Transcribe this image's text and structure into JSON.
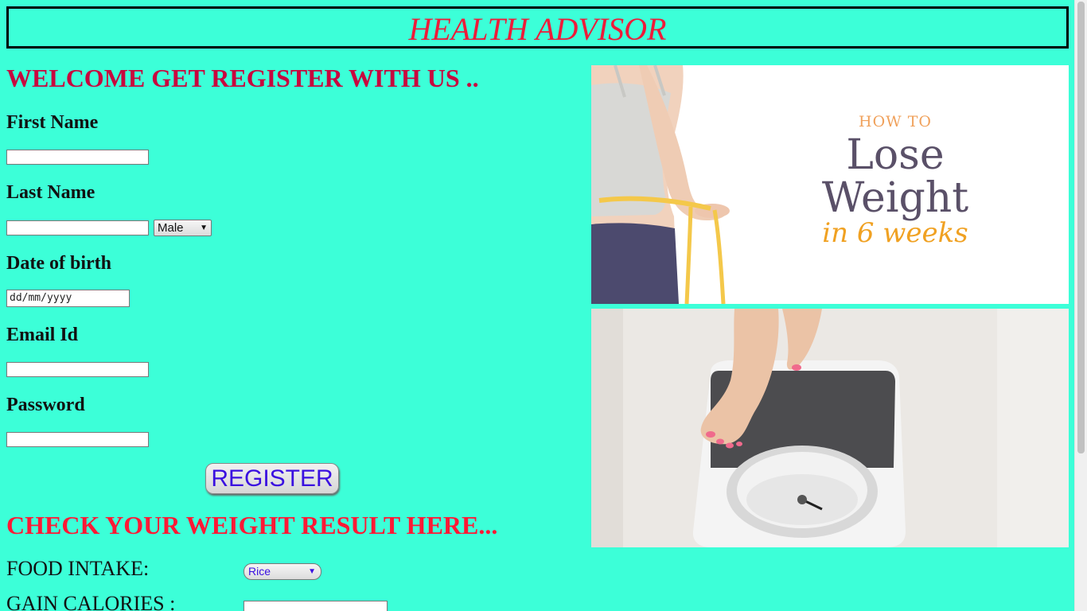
{
  "header": {
    "title": "HEALTH ADVISOR"
  },
  "register_form": {
    "heading": "WELCOME GET REGISTER WITH US ..",
    "first_name_label": "First Name",
    "last_name_label": "Last Name",
    "gender_value": "Male",
    "dob_label": "Date of birth",
    "dob_placeholder": "dd/mm/yyyy",
    "email_label": "Email Id",
    "password_label": "Password",
    "register_button": "REGISTER"
  },
  "weight_check": {
    "heading": "CHECK YOUR WEIGHT RESULT HERE...",
    "food_label": "FOOD INTAKE:",
    "food_value": "Rice",
    "gain_label": "GAIN CALORIES :"
  },
  "promo_image": {
    "line1": "HOW TO",
    "line2": "Lose",
    "line3": "Weight",
    "line4": "in 6 weeks"
  },
  "colors": {
    "background": "#3cffd8",
    "header_text": "#ee1b39",
    "welcome_text": "#c8063e",
    "check_text": "#ff1935",
    "button_text": "#3a10e0"
  }
}
